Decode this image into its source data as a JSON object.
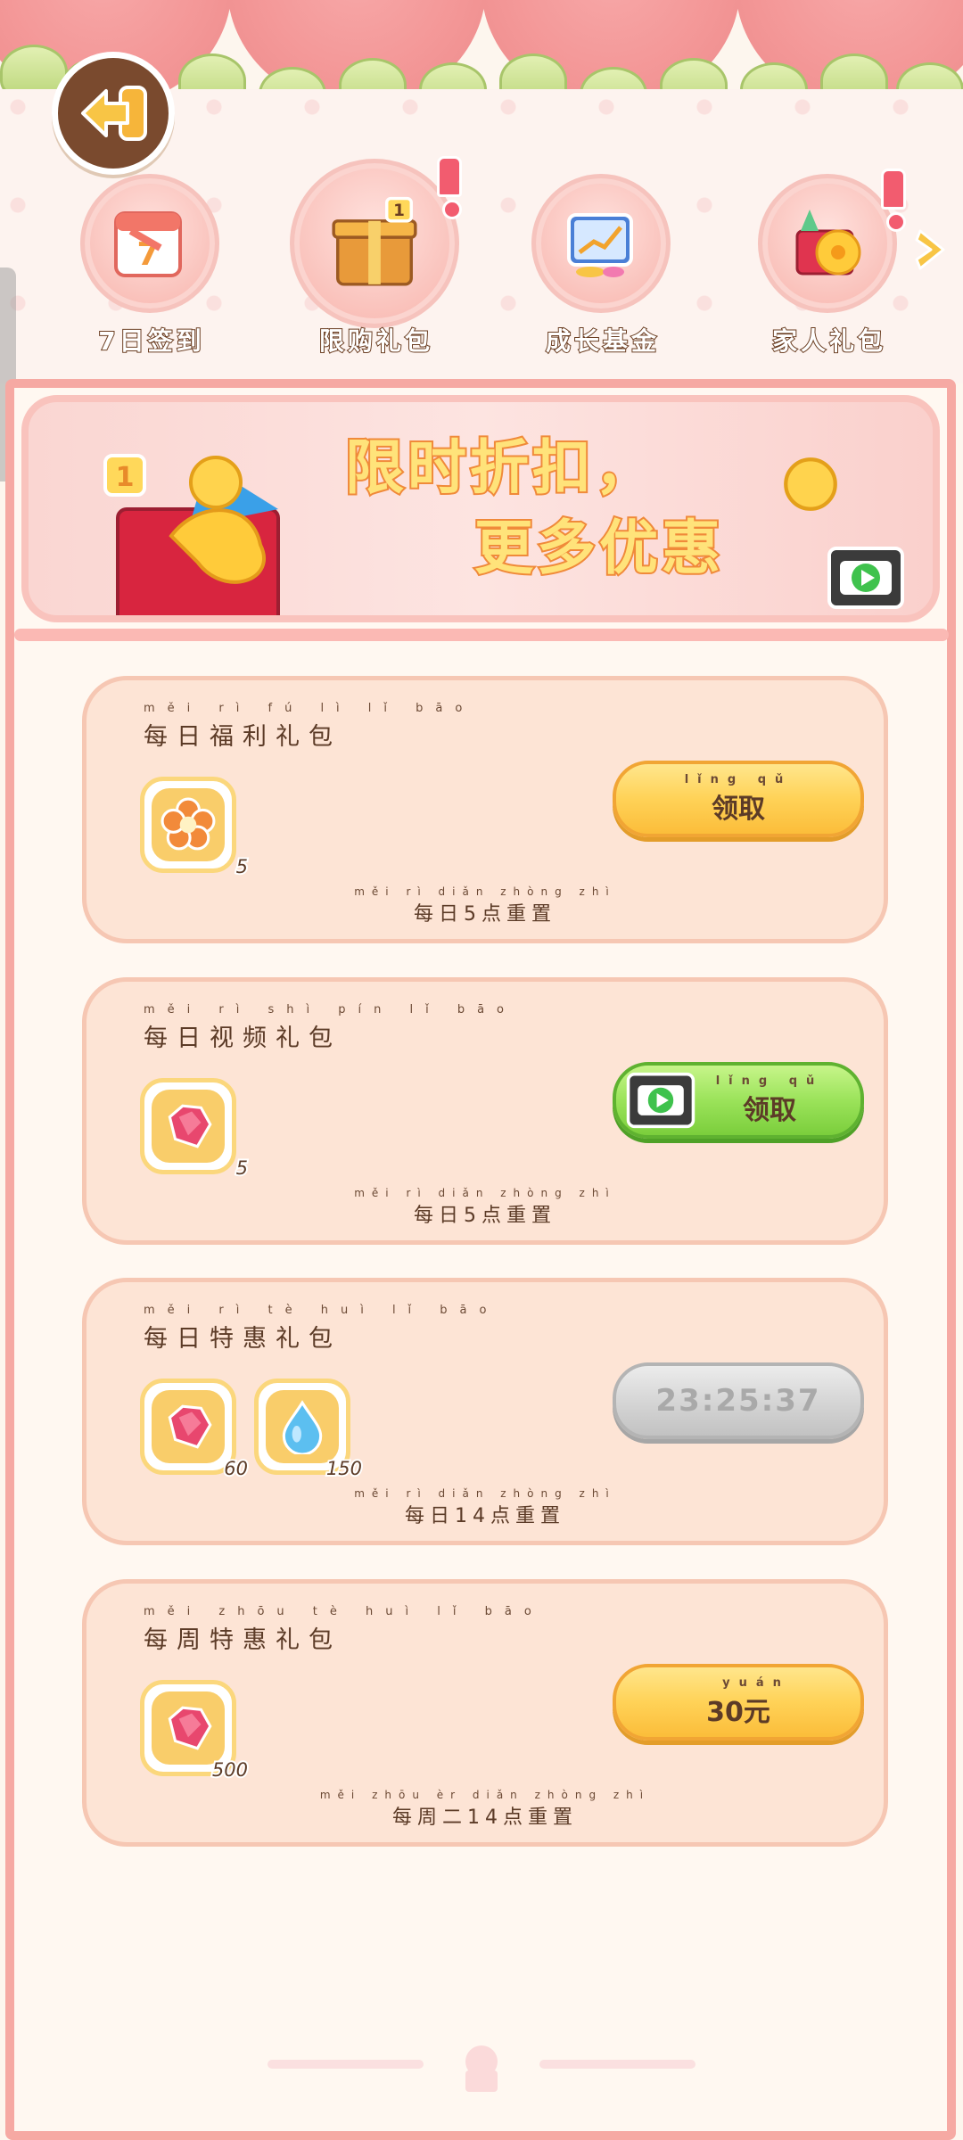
{
  "tabs": [
    {
      "label": "7日签到",
      "has_alert": false
    },
    {
      "label": "限购礼包",
      "has_alert": true
    },
    {
      "label": "成长基金",
      "has_alert": false
    },
    {
      "label": "家人礼包",
      "has_alert": true
    }
  ],
  "banner": {
    "line1": "限时折扣，",
    "line2": "更多优惠"
  },
  "cards": [
    {
      "title": "每日福利礼包",
      "title_pinyin": "měi rì fú lì lǐ bāo",
      "items": [
        {
          "icon": "flower-icon",
          "qty": "5"
        }
      ],
      "button": {
        "type": "yellow",
        "label": "领取",
        "pinyin": "lǐng qǔ"
      },
      "reset": "每日5点重置",
      "reset_pinyin": "měi rì diǎn zhòng zhì"
    },
    {
      "title": "每日视频礼包",
      "title_pinyin": "měi rì shì pín lǐ bāo",
      "items": [
        {
          "icon": "gem-icon",
          "qty": "5"
        }
      ],
      "button": {
        "type": "green",
        "label": "领取",
        "pinyin": "lǐng qǔ"
      },
      "reset": "每日5点重置",
      "reset_pinyin": "měi rì diǎn zhòng zhì"
    },
    {
      "title": "每日特惠礼包",
      "title_pinyin": "měi rì tè huì lǐ bāo",
      "items": [
        {
          "icon": "gem-icon",
          "qty": "60"
        },
        {
          "icon": "water-drop-icon",
          "qty": "150"
        }
      ],
      "button": {
        "type": "gray",
        "label": "23:25:37"
      },
      "reset": "每日14点重置",
      "reset_pinyin": "měi rì diǎn zhòng zhì"
    },
    {
      "title": "每周特惠礼包",
      "title_pinyin": "měi zhōu tè huì lǐ bāo",
      "items": [
        {
          "icon": "gem-icon",
          "qty": "500"
        }
      ],
      "button": {
        "type": "yellow",
        "label": "30元",
        "pinyin": "yuán"
      },
      "reset": "每周二14点重置",
      "reset_pinyin": "měi zhōu èr diǎn zhòng zhì"
    }
  ],
  "colors": {
    "panel_border": "#f6a9a3",
    "card_bg": "#fde4d5",
    "yellow_button": "#ffd257",
    "green_button": "#9be35a",
    "gray_button": "#d6d6d6",
    "text_brown": "#5c3b27"
  }
}
